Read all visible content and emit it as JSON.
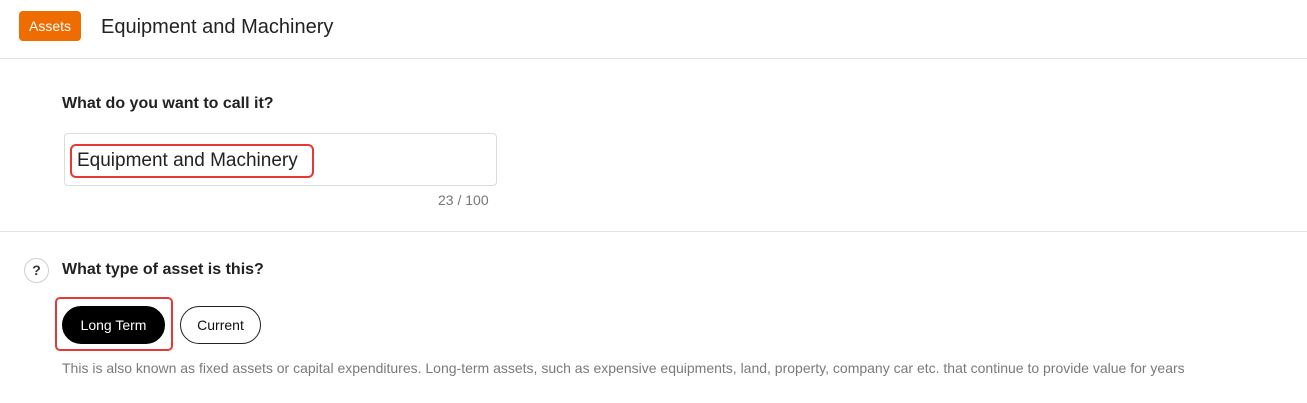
{
  "header": {
    "badge": "Assets",
    "title": "Equipment and Machinery"
  },
  "name_section": {
    "question": "What do you want to call it?",
    "value": "Equipment and Machinery",
    "char_count": "23 / 100"
  },
  "type_section": {
    "help_icon": "?",
    "question": "What type of asset is this?",
    "options": [
      "Long Term",
      "Current"
    ],
    "selected": "Long Term",
    "description": "This is also known as fixed assets or capital expenditures. Long-term assets, such as expensive equipments, land, property, company car etc. that continue to provide value for years"
  },
  "colors": {
    "badge": "#ef6c00",
    "highlight": "#e53935",
    "selected_option": "#000000"
  }
}
